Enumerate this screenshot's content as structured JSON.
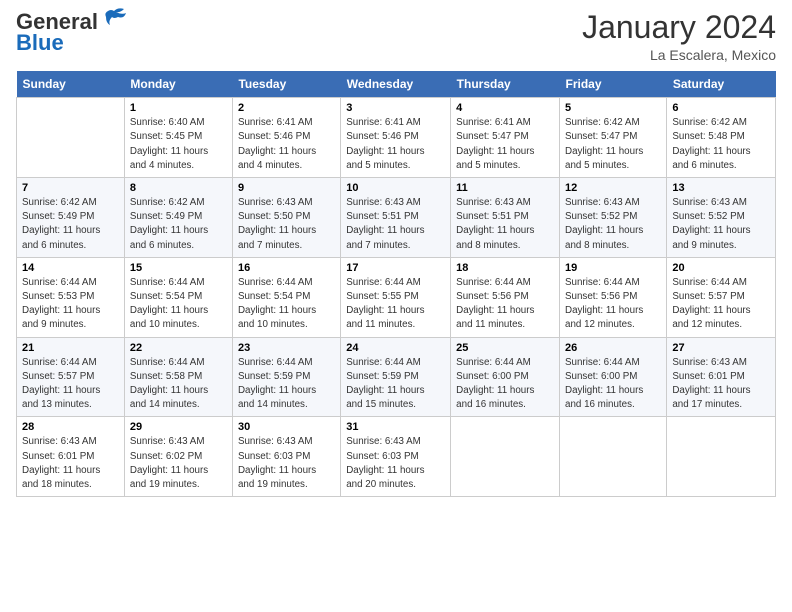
{
  "logo": {
    "line1": "General",
    "line2": "Blue"
  },
  "title": "January 2024",
  "location": "La Escalera, Mexico",
  "days_of_week": [
    "Sunday",
    "Monday",
    "Tuesday",
    "Wednesday",
    "Thursday",
    "Friday",
    "Saturday"
  ],
  "weeks": [
    [
      {
        "num": "",
        "info": ""
      },
      {
        "num": "1",
        "info": "Sunrise: 6:40 AM\nSunset: 5:45 PM\nDaylight: 11 hours\nand 4 minutes."
      },
      {
        "num": "2",
        "info": "Sunrise: 6:41 AM\nSunset: 5:46 PM\nDaylight: 11 hours\nand 4 minutes."
      },
      {
        "num": "3",
        "info": "Sunrise: 6:41 AM\nSunset: 5:46 PM\nDaylight: 11 hours\nand 5 minutes."
      },
      {
        "num": "4",
        "info": "Sunrise: 6:41 AM\nSunset: 5:47 PM\nDaylight: 11 hours\nand 5 minutes."
      },
      {
        "num": "5",
        "info": "Sunrise: 6:42 AM\nSunset: 5:47 PM\nDaylight: 11 hours\nand 5 minutes."
      },
      {
        "num": "6",
        "info": "Sunrise: 6:42 AM\nSunset: 5:48 PM\nDaylight: 11 hours\nand 6 minutes."
      }
    ],
    [
      {
        "num": "7",
        "info": "Sunrise: 6:42 AM\nSunset: 5:49 PM\nDaylight: 11 hours\nand 6 minutes."
      },
      {
        "num": "8",
        "info": "Sunrise: 6:42 AM\nSunset: 5:49 PM\nDaylight: 11 hours\nand 6 minutes."
      },
      {
        "num": "9",
        "info": "Sunrise: 6:43 AM\nSunset: 5:50 PM\nDaylight: 11 hours\nand 7 minutes."
      },
      {
        "num": "10",
        "info": "Sunrise: 6:43 AM\nSunset: 5:51 PM\nDaylight: 11 hours\nand 7 minutes."
      },
      {
        "num": "11",
        "info": "Sunrise: 6:43 AM\nSunset: 5:51 PM\nDaylight: 11 hours\nand 8 minutes."
      },
      {
        "num": "12",
        "info": "Sunrise: 6:43 AM\nSunset: 5:52 PM\nDaylight: 11 hours\nand 8 minutes."
      },
      {
        "num": "13",
        "info": "Sunrise: 6:43 AM\nSunset: 5:52 PM\nDaylight: 11 hours\nand 9 minutes."
      }
    ],
    [
      {
        "num": "14",
        "info": "Sunrise: 6:44 AM\nSunset: 5:53 PM\nDaylight: 11 hours\nand 9 minutes."
      },
      {
        "num": "15",
        "info": "Sunrise: 6:44 AM\nSunset: 5:54 PM\nDaylight: 11 hours\nand 10 minutes."
      },
      {
        "num": "16",
        "info": "Sunrise: 6:44 AM\nSunset: 5:54 PM\nDaylight: 11 hours\nand 10 minutes."
      },
      {
        "num": "17",
        "info": "Sunrise: 6:44 AM\nSunset: 5:55 PM\nDaylight: 11 hours\nand 11 minutes."
      },
      {
        "num": "18",
        "info": "Sunrise: 6:44 AM\nSunset: 5:56 PM\nDaylight: 11 hours\nand 11 minutes."
      },
      {
        "num": "19",
        "info": "Sunrise: 6:44 AM\nSunset: 5:56 PM\nDaylight: 11 hours\nand 12 minutes."
      },
      {
        "num": "20",
        "info": "Sunrise: 6:44 AM\nSunset: 5:57 PM\nDaylight: 11 hours\nand 12 minutes."
      }
    ],
    [
      {
        "num": "21",
        "info": "Sunrise: 6:44 AM\nSunset: 5:57 PM\nDaylight: 11 hours\nand 13 minutes."
      },
      {
        "num": "22",
        "info": "Sunrise: 6:44 AM\nSunset: 5:58 PM\nDaylight: 11 hours\nand 14 minutes."
      },
      {
        "num": "23",
        "info": "Sunrise: 6:44 AM\nSunset: 5:59 PM\nDaylight: 11 hours\nand 14 minutes."
      },
      {
        "num": "24",
        "info": "Sunrise: 6:44 AM\nSunset: 5:59 PM\nDaylight: 11 hours\nand 15 minutes."
      },
      {
        "num": "25",
        "info": "Sunrise: 6:44 AM\nSunset: 6:00 PM\nDaylight: 11 hours\nand 16 minutes."
      },
      {
        "num": "26",
        "info": "Sunrise: 6:44 AM\nSunset: 6:00 PM\nDaylight: 11 hours\nand 16 minutes."
      },
      {
        "num": "27",
        "info": "Sunrise: 6:43 AM\nSunset: 6:01 PM\nDaylight: 11 hours\nand 17 minutes."
      }
    ],
    [
      {
        "num": "28",
        "info": "Sunrise: 6:43 AM\nSunset: 6:01 PM\nDaylight: 11 hours\nand 18 minutes."
      },
      {
        "num": "29",
        "info": "Sunrise: 6:43 AM\nSunset: 6:02 PM\nDaylight: 11 hours\nand 19 minutes."
      },
      {
        "num": "30",
        "info": "Sunrise: 6:43 AM\nSunset: 6:03 PM\nDaylight: 11 hours\nand 19 minutes."
      },
      {
        "num": "31",
        "info": "Sunrise: 6:43 AM\nSunset: 6:03 PM\nDaylight: 11 hours\nand 20 minutes."
      },
      {
        "num": "",
        "info": ""
      },
      {
        "num": "",
        "info": ""
      },
      {
        "num": "",
        "info": ""
      }
    ]
  ]
}
